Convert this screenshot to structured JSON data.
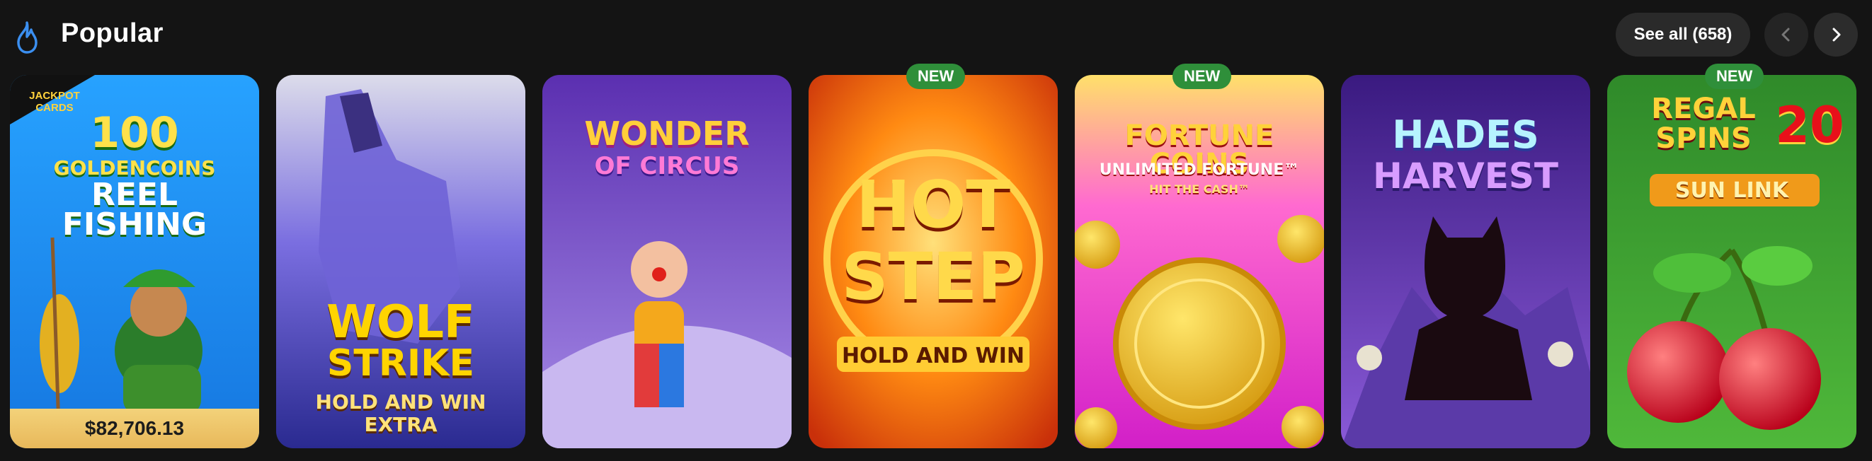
{
  "header": {
    "title": "Popular",
    "see_all_label": "See all (658)",
    "icons": {
      "section": "flame-icon",
      "prev": "chevron-left-icon",
      "next": "chevron-right-icon"
    }
  },
  "cards": [
    {
      "title_lines": [
        "100",
        "GOLDENCOINS",
        "REEL",
        "FISHING"
      ],
      "corner_badge": "JACKPOT CARDS",
      "jackpot": "$82,706.13",
      "accent": "#1f8ef0"
    },
    {
      "title_lines": [
        "WOLF",
        "STRIKE"
      ],
      "subtitle_lines": [
        "HOLD AND WIN",
        "EXTRA"
      ],
      "accent": "#6f4fd6"
    },
    {
      "title_lines": [
        "WONDER",
        "OF CIRCUS"
      ],
      "accent": "#7a3fd0"
    },
    {
      "badge": "NEW",
      "title_lines": [
        "HOT",
        "STEP"
      ],
      "subtitle_lines": [
        "HOLD AND WIN"
      ],
      "accent": "#f07a10"
    },
    {
      "badge": "NEW",
      "title_lines": [
        "FORTUNE COINS"
      ],
      "subtitle_lines": [
        "UNLIMITED FORTUNE™",
        "HIT THE CASH™"
      ],
      "accent": "#e03bd0"
    },
    {
      "title_lines": [
        "HADES",
        "HARVEST"
      ],
      "accent": "#6b3fc7"
    },
    {
      "badge": "NEW",
      "title_lines": [
        "REGAL",
        "SPINS"
      ],
      "number": "20",
      "subtitle_lines": [
        "SUN LINK"
      ],
      "accent": "#3fa32c"
    }
  ]
}
